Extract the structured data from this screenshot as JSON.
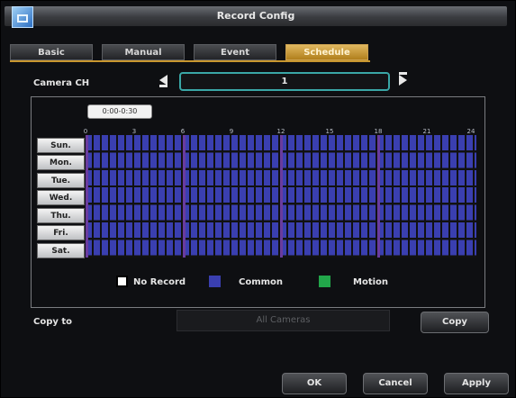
{
  "window": {
    "title": "Record Config"
  },
  "tabs": [
    {
      "label": "Basic",
      "active": false
    },
    {
      "label": "Manual",
      "active": false
    },
    {
      "label": "Event",
      "active": false
    },
    {
      "label": "Schedule",
      "active": true
    }
  ],
  "camera": {
    "label": "Camera CH",
    "value": "1"
  },
  "schedule": {
    "time_tip": "0:00-0:30",
    "hour_labels": [
      "0",
      "3",
      "6",
      "9",
      "12",
      "15",
      "18",
      "21",
      "24"
    ],
    "days": [
      "Sun.",
      "Mon.",
      "Tue.",
      "Wed.",
      "Thu.",
      "Fri.",
      "Sat."
    ],
    "legend": {
      "no_record": "No Record",
      "common": "Common",
      "motion": "Motion"
    },
    "colors": {
      "no_record": "#ffffff",
      "common": "#3a3fb0",
      "motion": "#22a64a",
      "hour_marker": "#6a3b9e"
    }
  },
  "copy": {
    "label": "Copy to",
    "target": "All Cameras",
    "button": "Copy"
  },
  "buttons": {
    "ok": "OK",
    "cancel": "Cancel",
    "apply": "Apply"
  },
  "icons": {
    "app": "camera-config-icon",
    "prev": "arrow-left-icon",
    "next": "arrow-right-icon"
  }
}
